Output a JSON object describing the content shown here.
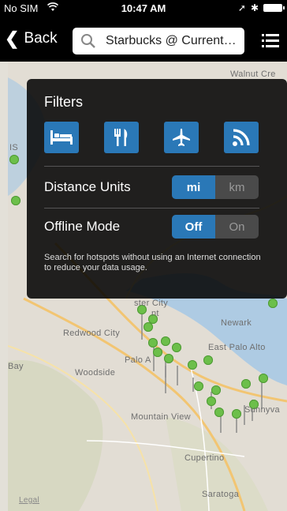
{
  "status_bar": {
    "carrier": "No SIM",
    "wifi_icon": "wifi-icon",
    "time": "10:47 AM",
    "location_icon": "location-arrow-icon",
    "bluetooth_icon": "bluetooth-icon",
    "battery_icon": "battery-icon"
  },
  "nav": {
    "back_label": "Back",
    "search_value": "Starbucks @ Current…",
    "list_icon": "list-icon"
  },
  "filters": {
    "title": "Filters",
    "buttons": [
      {
        "name": "hotel",
        "icon": "bed-icon"
      },
      {
        "name": "food",
        "icon": "fork-knife-icon"
      },
      {
        "name": "airport",
        "icon": "airplane-icon"
      },
      {
        "name": "hotspot",
        "icon": "wifi-signal-icon"
      }
    ],
    "distance_units": {
      "label": "Distance Units",
      "options": [
        "mi",
        "km"
      ],
      "selected": "mi"
    },
    "offline_mode": {
      "label": "Offline Mode",
      "options": [
        "Off",
        "On"
      ],
      "selected": "Off"
    },
    "note": "Search for hotspots without using an Internet connection to reduce your data usage."
  },
  "map": {
    "labels": {
      "walnut_creek": "Walnut Cre",
      "foster_city": "ster City",
      "nt": "nt",
      "newark": "Newark",
      "redwood_city": "Redwood City",
      "east_palo_alto": "East Palo Alto",
      "bay": "Bay",
      "woodside": "Woodside",
      "palo_alto": "Palo A",
      "mountain_view": "Mountain View",
      "sunnyvale": "Sunnyva",
      "cupertino": "Cupertino",
      "saratoga": "Saratoga",
      "is": "IS",
      "legal": "Legal"
    },
    "colors": {
      "water": "#aecbe3",
      "land": "#e2ddd4",
      "park": "#cfe0b8",
      "pin": "#6cbf4a"
    }
  }
}
